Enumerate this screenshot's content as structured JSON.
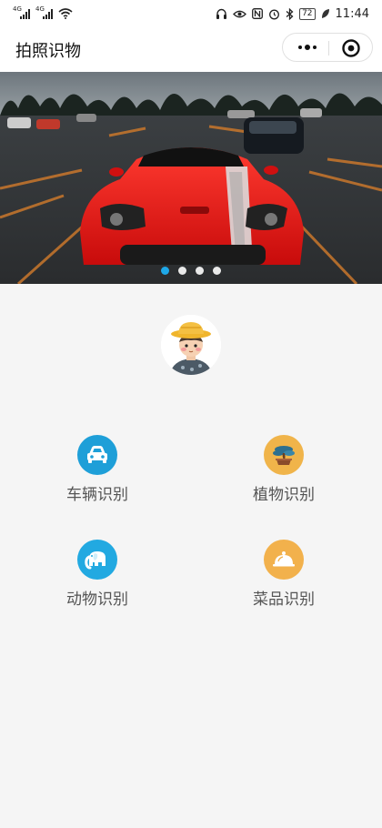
{
  "status_bar": {
    "network_1": "4G",
    "network_2": "4G",
    "battery": "72",
    "time": "11:44"
  },
  "header": {
    "title": "拍照识物"
  },
  "banner": {
    "slide_count": 4,
    "active_index": 0,
    "colors": {
      "active_dot": "#1ea8e8",
      "inactive_dot": "#e9e9e9"
    }
  },
  "features": [
    {
      "label": "车辆识别",
      "icon": "car-icon",
      "color": "#1e9fd8"
    },
    {
      "label": "植物识别",
      "icon": "bonsai-icon",
      "color": "#f0b44a"
    },
    {
      "label": "动物识别",
      "icon": "elephant-icon",
      "color": "#22a9e1"
    },
    {
      "label": "菜品识别",
      "icon": "cloche-icon",
      "color": "#f2b14c"
    }
  ]
}
